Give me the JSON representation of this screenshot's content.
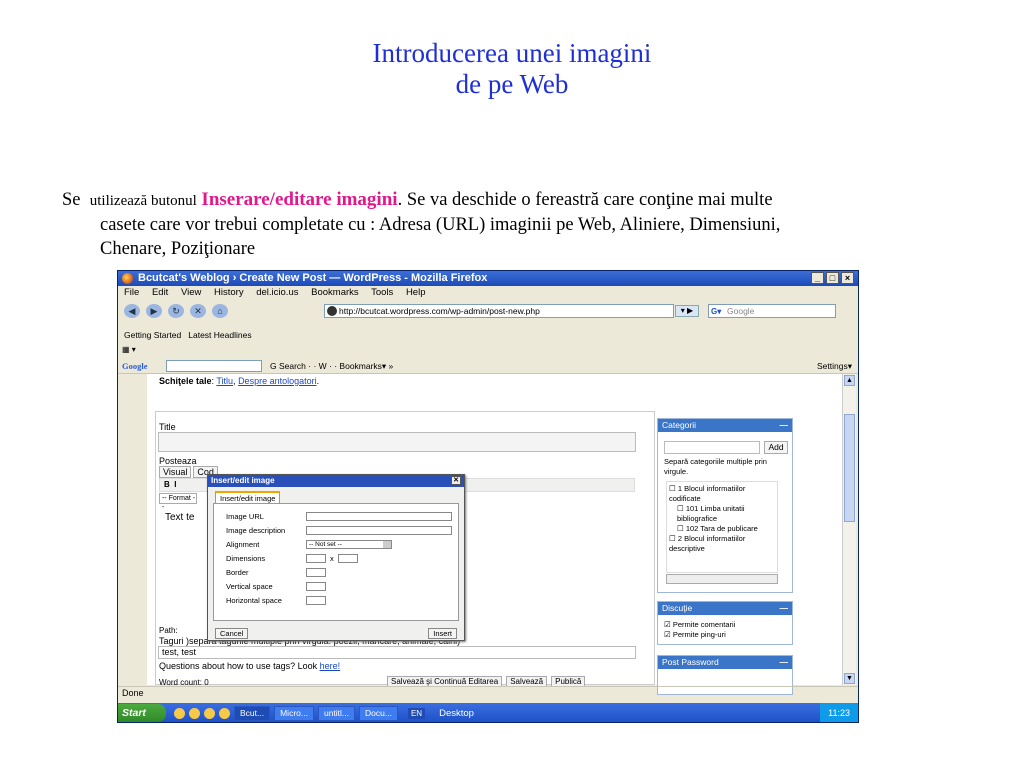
{
  "slide": {
    "title_line1": "Introducerea unei imagini",
    "title_line2": "de pe Web",
    "body_prefix_a": "Se",
    "body_prefix_b": "utilizează butonul",
    "body_highlight": "Inserare/editare imagini",
    "body_after": ". Se va deschide o fereastră care conţine mai multe",
    "body_line2": "casete care vor trebui completate cu  : Adresa (URL) imaginii pe Web, Aliniere, Dimensiuni,",
    "body_line3": "Chenare, Poziţionare"
  },
  "window": {
    "title": "Bcutcat's Weblog › Create New Post — WordPress - Mozilla Firefox",
    "buttons": [
      "_",
      "□",
      "×"
    ],
    "menu": [
      "File",
      "Edit",
      "View",
      "History",
      "del.icio.us",
      "Bookmarks",
      "Tools",
      "Help"
    ],
    "url": "http://bcutcat.wordpress.com/wp-admin/post-new.php",
    "search_placeholder": "Google",
    "bookmarks": [
      "Getting Started",
      "Latest Headlines"
    ],
    "google_bar": {
      "logo": "Google",
      "items": "G Search ·  · W  · ·  Bookmarks▾ »",
      "settings": "Settings▾"
    },
    "status": "Done"
  },
  "wp": {
    "drafts_label": "Schiţele tale",
    "drafts_links": [
      "Titlu",
      "Despre antologatori"
    ],
    "title_label": "Title",
    "post_label": "Posteaza",
    "tab_visual": "Visual",
    "tab_code": "Cod",
    "format_label": "-- Format --",
    "text_preview": "Text te",
    "path_label": "Path:",
    "tags_label": "Taguri )separă tagurile multiple prin virgulă: poezii, mâncare, animale, câini)",
    "tags_value": "test, test",
    "tags_question": "Questions about how to use tags? Look ",
    "tags_link": "here!",
    "word_count": "Word count: 0",
    "save_buttons": [
      "Salvează şi Continuă Editarea",
      "Salvează",
      "Publică"
    ]
  },
  "sidebar": {
    "categories": {
      "title": "Categorii",
      "add": "Add",
      "hint": "Separă categoriile multiple prin virgule.",
      "items": [
        {
          "label": "1 Blocul informatiilor codificate",
          "indent": false
        },
        {
          "label": "101 Limba unitatii bibliografice",
          "indent": true
        },
        {
          "label": "102 Tara de publicare",
          "indent": true
        },
        {
          "label": "2 Blocul informatiilor descriptive",
          "indent": false
        }
      ]
    },
    "discussion": {
      "title": "Discuţie",
      "options": [
        "Permite comentarii",
        "Permite ping-uri"
      ]
    },
    "password": {
      "title": "Post Password"
    }
  },
  "dialog": {
    "title": "Insert/edit image",
    "tab": "Insert/edit image",
    "fields": {
      "url": "Image URL",
      "description": "Image description",
      "alignment": "Alignment",
      "alignment_value": "-- Not set --",
      "dimensions": "Dimensions",
      "dim_sep": "x",
      "border": "Border",
      "vspace": "Vertical space",
      "hspace": "Horizontal space"
    },
    "cancel": "Cancel",
    "insert": "Insert"
  },
  "taskbar": {
    "start": "Start",
    "tasks": [
      "Bcut...",
      "Micro...",
      "untitl...",
      "Docu..."
    ],
    "lang": "EN",
    "desktop": "Desktop",
    "clock": "11:23"
  }
}
